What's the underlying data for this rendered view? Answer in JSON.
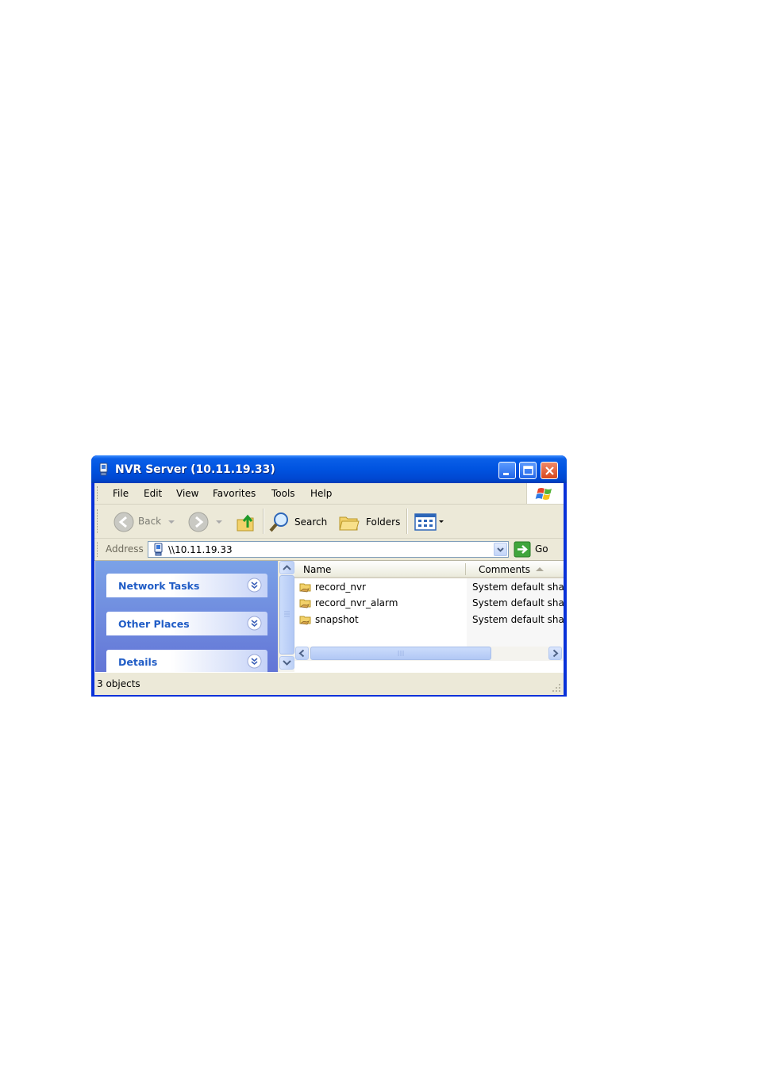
{
  "window": {
    "title": "NVR Server (10.11.19.33)"
  },
  "menu": {
    "items": [
      "File",
      "Edit",
      "View",
      "Favorites",
      "Tools",
      "Help"
    ]
  },
  "toolbar": {
    "back_label": "Back",
    "search_label": "Search",
    "folders_label": "Folders"
  },
  "address": {
    "label": "Address",
    "value": "\\\\10.11.19.33",
    "go_label": "Go"
  },
  "taskpane": {
    "panels": [
      "Network Tasks",
      "Other Places",
      "Details"
    ]
  },
  "filelist": {
    "columns": {
      "name": "Name",
      "comments": "Comments"
    },
    "rows": [
      {
        "name": "record_nvr",
        "comment": "System default share"
      },
      {
        "name": "record_nvr_alarm",
        "comment": "System default share"
      },
      {
        "name": "snapshot",
        "comment": "System default share"
      }
    ]
  },
  "status": {
    "text": "3 objects"
  },
  "colors": {
    "titlebar": "#0053e0",
    "taskpane": "#6f8ddf",
    "panel_title": "#215dc6",
    "chrome": "#ece9d8"
  }
}
